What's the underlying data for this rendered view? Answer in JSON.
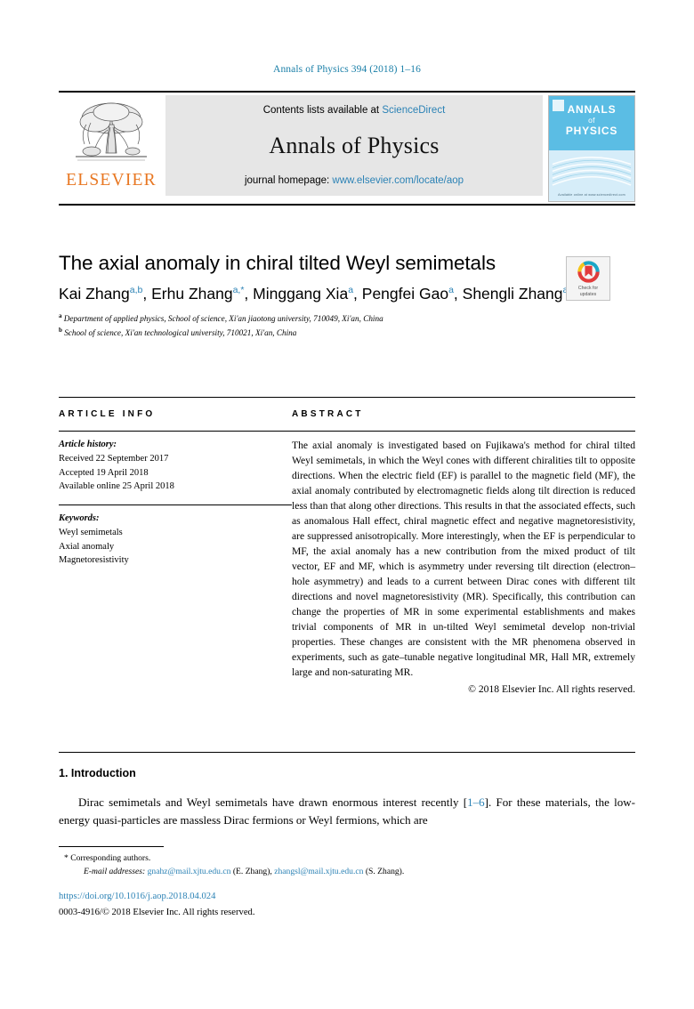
{
  "running_head": "Annals of Physics 394 (2018) 1–16",
  "masthead": {
    "publisher": "ELSEVIER",
    "contents_prefix": "Contents lists available at ",
    "contents_link": "ScienceDirect",
    "journal_name": "Annals of Physics",
    "homepage_prefix": "journal homepage: ",
    "homepage_link": "www.elsevier.com/locate/aop",
    "cover": {
      "line1": "ANNALS",
      "line2": "of",
      "line3": "PHYSICS",
      "footer": "Available online at www.sciencedirect.com"
    }
  },
  "article": {
    "title": "The axial anomaly in chiral tilted Weyl semimetals",
    "authors": [
      {
        "name": "Kai Zhang",
        "marks": "a,b",
        "sep": ", "
      },
      {
        "name": "Erhu Zhang",
        "marks": "a,*",
        "sep": ", "
      },
      {
        "name": "Minggang Xia",
        "marks": "a",
        "sep": ", "
      },
      {
        "name": "Pengfei Gao",
        "marks": "a",
        "sep": ", "
      },
      {
        "name": "Shengli Zhang",
        "marks": "a,*",
        "sep": ""
      }
    ],
    "affiliations": [
      {
        "mark": "a",
        "text": "Department of applied physics, School of science, Xi'an jiaotong university, 710049, Xi'an, China"
      },
      {
        "mark": "b",
        "text": "School of science, Xi'an technological university, 710021, Xi'an, China"
      }
    ],
    "crossmark": {
      "line1": "Check for",
      "line2": "updates"
    }
  },
  "info": {
    "heading": "ARTICLE INFO",
    "history_label": "Article history:",
    "history": [
      "Received 22 September 2017",
      "Accepted 19 April 2018",
      "Available online 25 April 2018"
    ],
    "keywords_label": "Keywords:",
    "keywords": [
      "Weyl semimetals",
      "Axial anomaly",
      "Magnetoresistivity"
    ]
  },
  "abstract": {
    "heading": "ABSTRACT",
    "body": "The axial anomaly is investigated based on Fujikawa's method for chiral tilted Weyl semimetals, in which the Weyl cones with different chiralities tilt to opposite directions. When the electric field (EF) is parallel to the magnetic field (MF), the axial anomaly contributed by electromagnetic fields along tilt direction is reduced less than that along other directions. This results in that the associated effects, such as anomalous Hall effect, chiral magnetic effect and negative magnetoresistivity, are suppressed anisotropically. More interestingly, when the EF is perpendicular to MF, the axial anomaly has a new contribution from the mixed product of tilt vector, EF and MF, which is asymmetry under reversing tilt direction (electron–hole asymmetry) and leads to a current between Dirac cones with different tilt directions and novel magnetoresistivity (MR). Specifically, this contribution can change the properties of MR in some experimental establishments and makes trivial components of MR in un-tilted Weyl semimetal develop non-trivial properties. These changes are consistent with the MR phenomena observed in experiments, such as gate–tunable negative longitudinal MR, Hall MR, extremely large and non-saturating MR.",
    "copyright": "© 2018 Elsevier Inc. All rights reserved."
  },
  "introduction": {
    "heading": "1. Introduction",
    "para_pre": "Dirac semimetals and Weyl semimetals have drawn enormous interest   recently [",
    "para_ref": "1–6",
    "para_post": "]. For these materials, the low-energy quasi-particles are massless Dirac fermions or Weyl fermions, which are"
  },
  "footnotes": {
    "corresponding": "* Corresponding authors.",
    "email_label": "E-mail addresses:",
    "emails": [
      {
        "address": "gnahz@mail.xjtu.edu.cn",
        "owner": "(E. Zhang)",
        "sep": ", "
      },
      {
        "address": "zhangsl@mail.xjtu.edu.cn",
        "owner": "(S. Zhang)",
        "sep": "."
      }
    ],
    "doi": "https://doi.org/10.1016/j.aop.2018.04.024",
    "issn": "0003-4916/© 2018 Elsevier Inc. All rights reserved."
  },
  "colors": {
    "link": "#2b82b5",
    "running_head": "#1a7fa8",
    "elsevier_orange": "#E87722",
    "cover_blue": "#5bbde4"
  }
}
